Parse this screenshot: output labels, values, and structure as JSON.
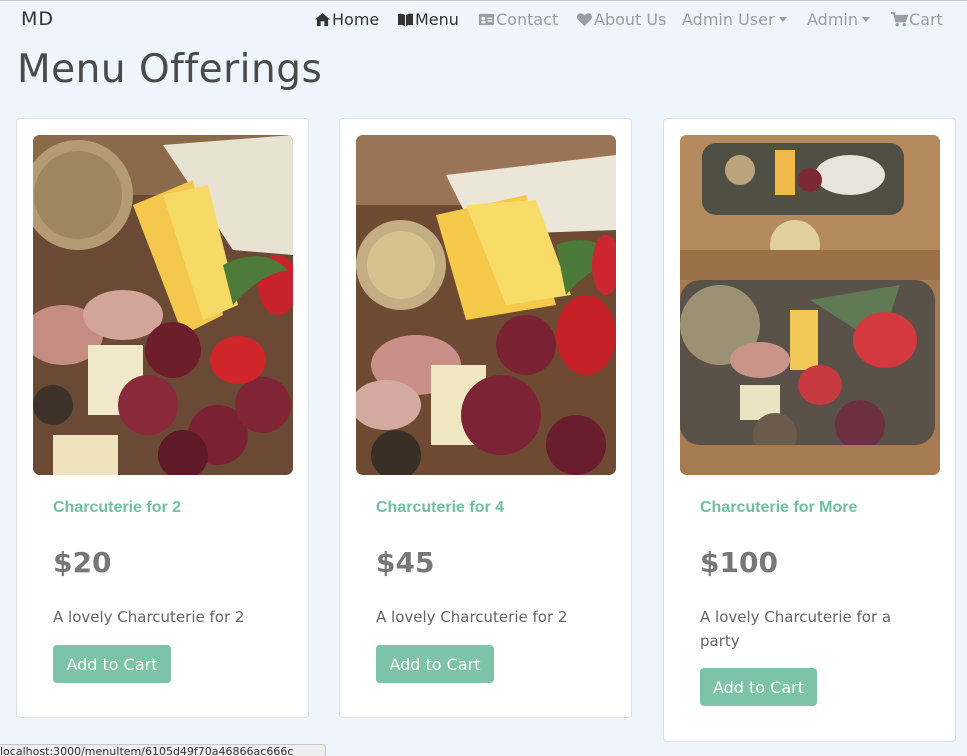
{
  "brand": "MD",
  "nav": {
    "home": {
      "label": "Home",
      "icon": "home-icon"
    },
    "menu": {
      "label": "Menu",
      "icon": "book-icon"
    },
    "contact": {
      "label": "Contact",
      "icon": "id-card-icon"
    },
    "about": {
      "label": "About Us",
      "icon": "heart-icon"
    },
    "admin_user": {
      "label": "Admin User"
    },
    "admin": {
      "label": "Admin"
    },
    "cart": {
      "label": "Cart",
      "icon": "cart-icon"
    }
  },
  "page_title": "Menu Offerings",
  "cards": [
    {
      "title": "Charcuterie for 2",
      "price": "$20",
      "description": "A lovely Charcuterie for 2",
      "button": "Add to Cart"
    },
    {
      "title": "Charcuterie for 4",
      "price": "$45",
      "description": "A lovely Charcuterie for 2",
      "button": "Add to Cart"
    },
    {
      "title": "Charcuterie for More",
      "price": "$100",
      "description": "A lovely Charcuterie for a party",
      "button": "Add to Cart"
    }
  ],
  "status_url": "localhost:3000/menuItem/6105d49f70a46866ac666c",
  "colors": {
    "accent": "#7cc3a9",
    "title": "#6fbfa2",
    "background": "#eef5fd"
  }
}
